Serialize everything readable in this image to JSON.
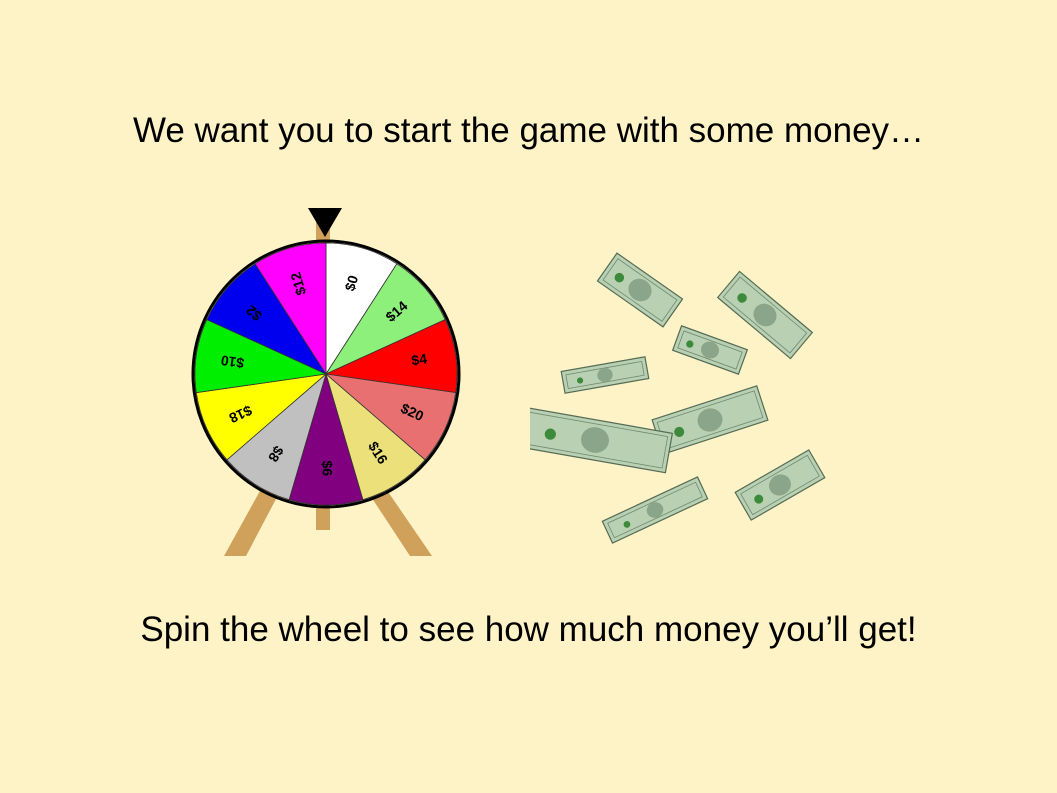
{
  "slide": {
    "heading": "We want you to start the game with some money…",
    "instruction": "Spin the wheel to see how much money you’ll get!"
  },
  "wheel": {
    "segments": [
      {
        "label": "$0",
        "color": "#ffffff"
      },
      {
        "label": "$14",
        "color": "#8cf07a"
      },
      {
        "label": "$4",
        "color": "#ff0000"
      },
      {
        "label": "$20",
        "color": "#e87070"
      },
      {
        "label": "$16",
        "color": "#ece07a"
      },
      {
        "label": "$6",
        "color": "#800080"
      },
      {
        "label": "$8",
        "color": "#c0c0c0"
      },
      {
        "label": "$18",
        "color": "#ffff00"
      },
      {
        "label": "$10",
        "color": "#00ee00"
      },
      {
        "label": "$2",
        "color": "#0000ee"
      },
      {
        "label": "$12",
        "color": "#ff00ff"
      }
    ],
    "pointer_icon": "triangle-down-icon",
    "stand_color": "#cfa15a"
  },
  "decor": {
    "bills_icon": "dollar-bills-icon",
    "bill_color": "#b9d0b2"
  }
}
